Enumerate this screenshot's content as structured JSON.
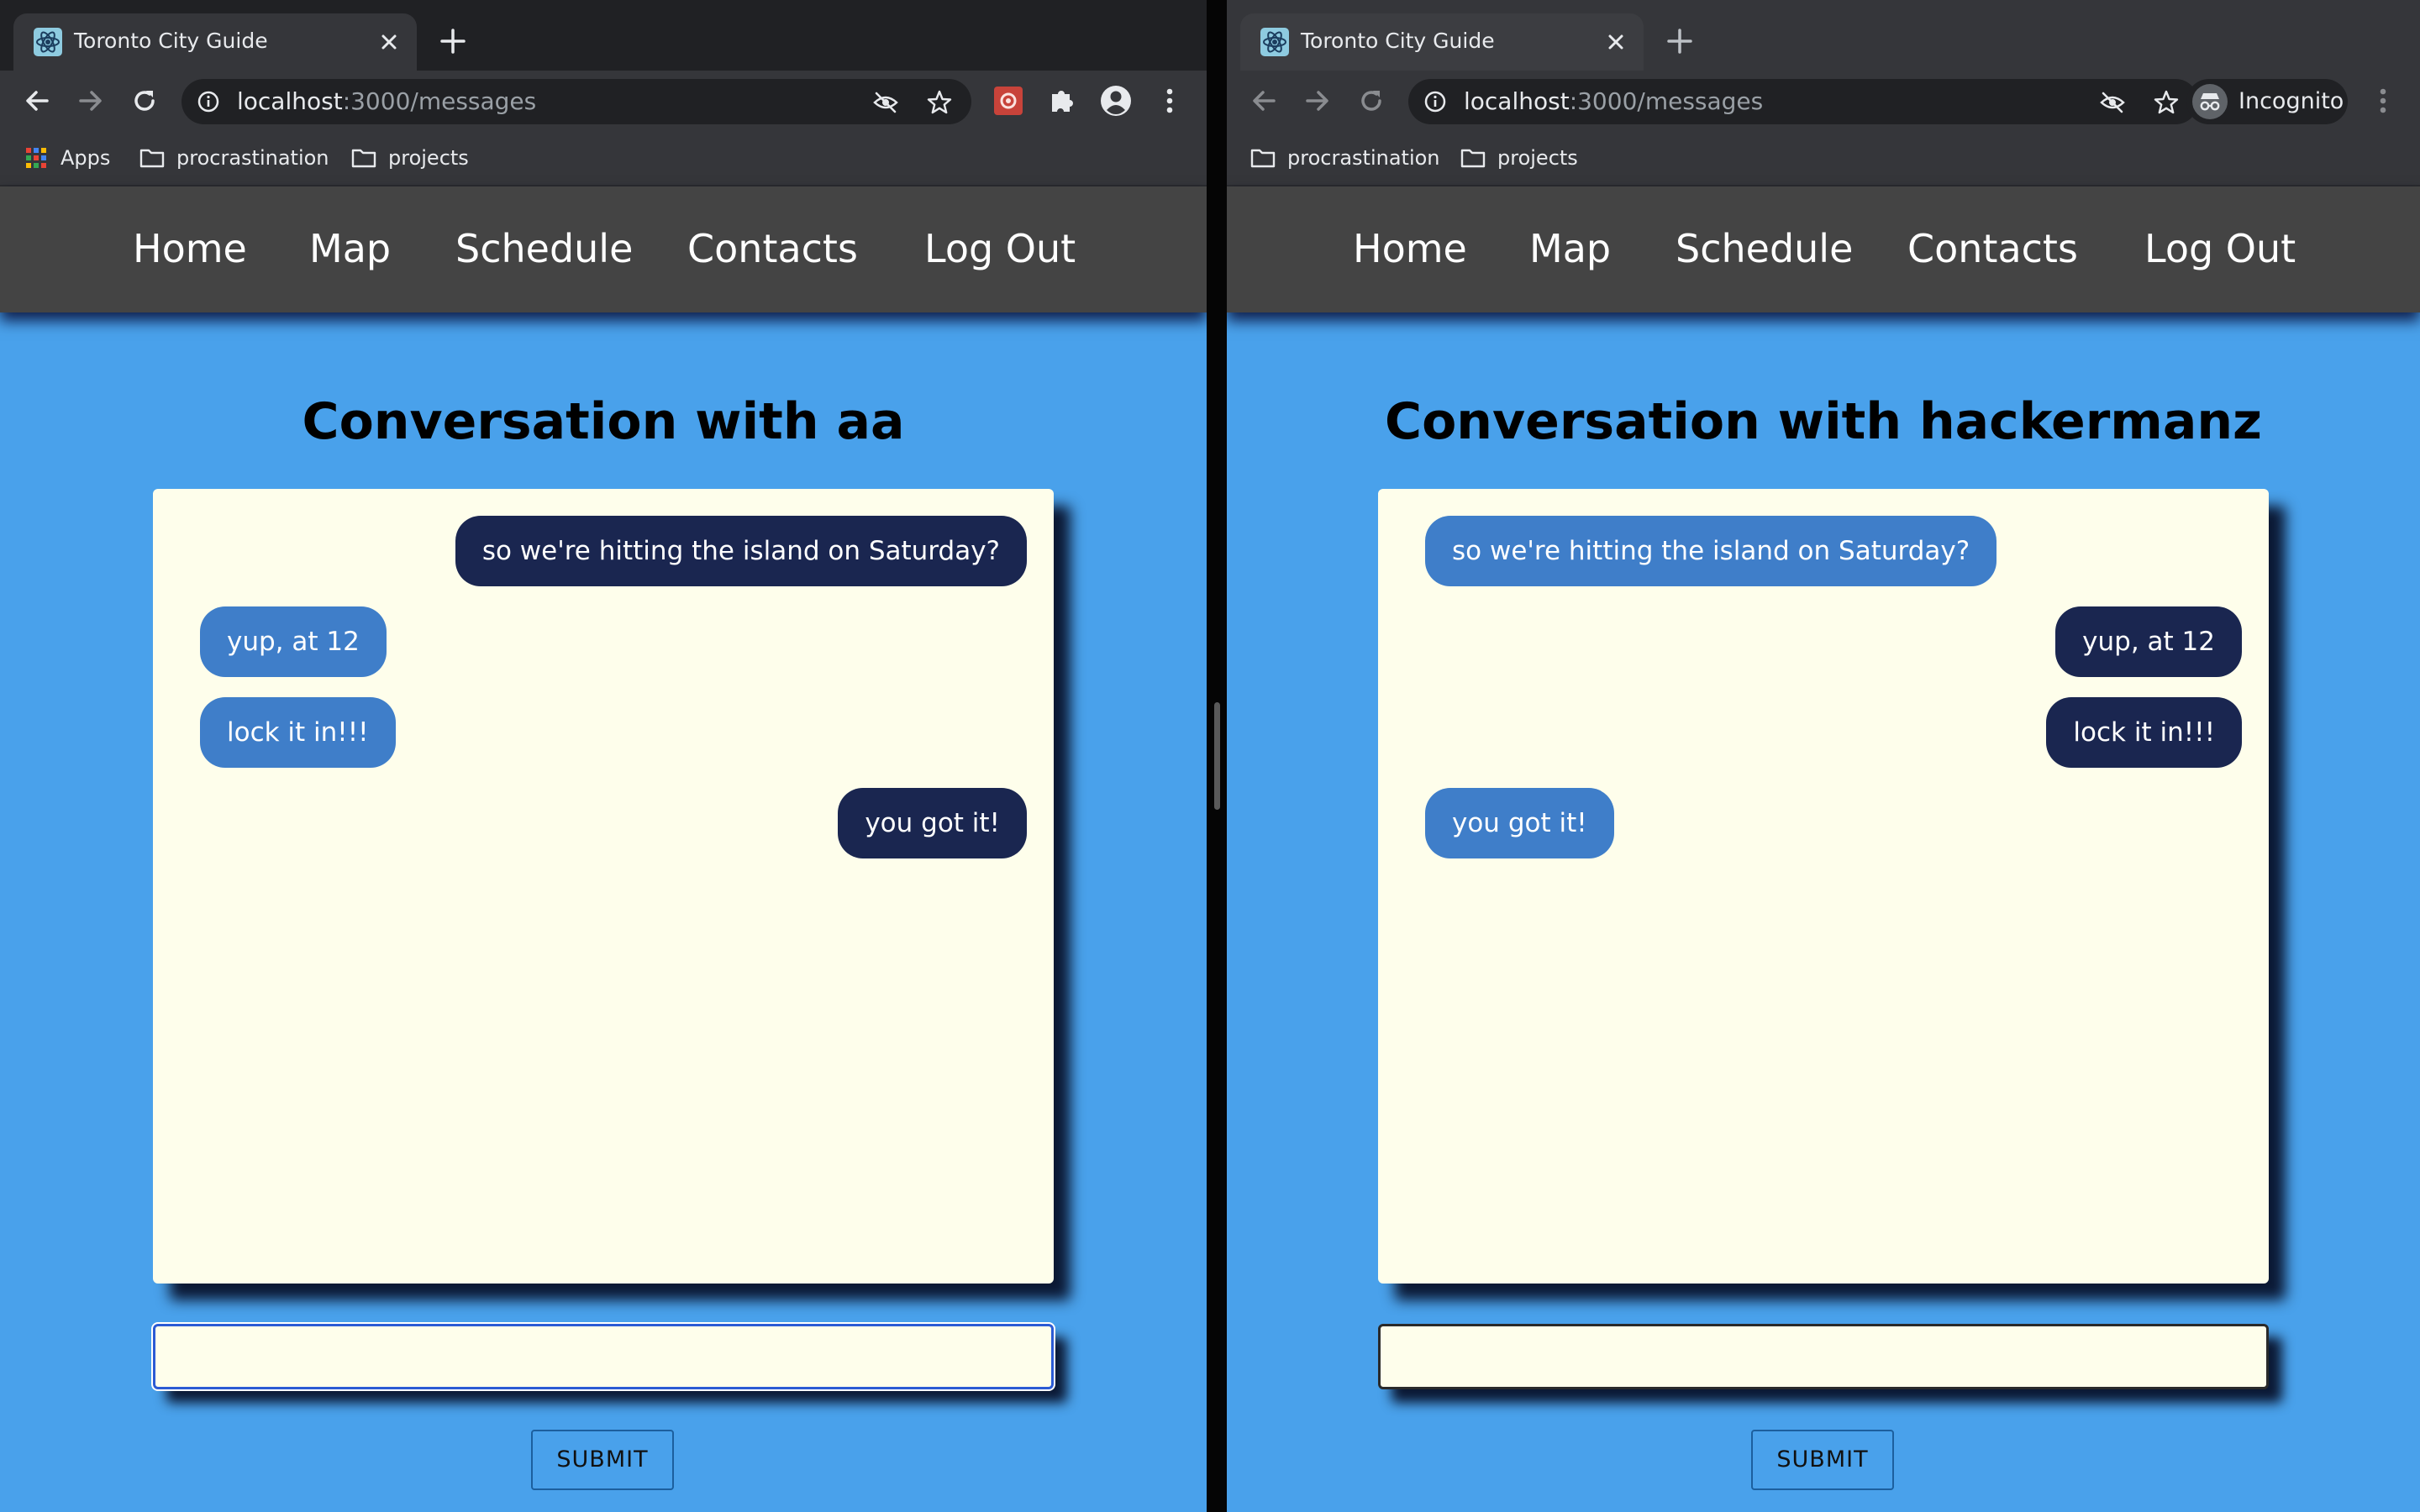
{
  "left": {
    "tab_title": "Toronto City Guide",
    "url_host": "localhost",
    "url_path": ":3000/messages",
    "bookmarks": [
      "Apps",
      "procrastination",
      "projects"
    ],
    "nav": [
      "Home",
      "Map",
      "Schedule",
      "Contacts",
      "Log Out"
    ],
    "title": "Conversation with aa",
    "messages": [
      {
        "text": "so we're hitting the island on Saturday?",
        "side": "right"
      },
      {
        "text": "yup, at 12",
        "side": "left"
      },
      {
        "text": "lock it in!!!",
        "side": "left"
      },
      {
        "text": "you got it!",
        "side": "right"
      }
    ],
    "input_value": "",
    "submit_label": "SUBMIT"
  },
  "right": {
    "tab_title": "Toronto City Guide",
    "url_host": "localhost",
    "url_path": ":3000/messages",
    "incognito_label": "Incognito",
    "bookmarks": [
      "procrastination",
      "projects"
    ],
    "nav": [
      "Home",
      "Map",
      "Schedule",
      "Contacts",
      "Log Out"
    ],
    "title": "Conversation with hackermanz",
    "messages": [
      {
        "text": "so we're hitting the island on Saturday?",
        "side": "left"
      },
      {
        "text": "yup, at 12",
        "side": "right"
      },
      {
        "text": "lock it in!!!",
        "side": "right"
      },
      {
        "text": "you got it!",
        "side": "left"
      }
    ],
    "input_value": "",
    "submit_label": "SUBMIT"
  },
  "icons": {
    "favicon": "react-atom-icon",
    "close": "close-icon",
    "new_tab": "plus-icon",
    "back": "back-arrow-icon",
    "forward": "forward-arrow-icon",
    "reload": "reload-icon",
    "info": "info-icon",
    "eye_off": "eye-off-icon",
    "star": "star-icon",
    "extension": "puzzle-icon",
    "profile": "account-icon",
    "menu": "kebab-menu-icon",
    "folder": "folder-icon",
    "apps": "apps-grid-icon",
    "incognito": "incognito-icon"
  },
  "colors": {
    "page_background": "#49a1eb",
    "navbar": "#444444",
    "chat_background": "#fefeeb",
    "bubble_sent": "#1a2650",
    "bubble_received": "#3f7ec9"
  }
}
